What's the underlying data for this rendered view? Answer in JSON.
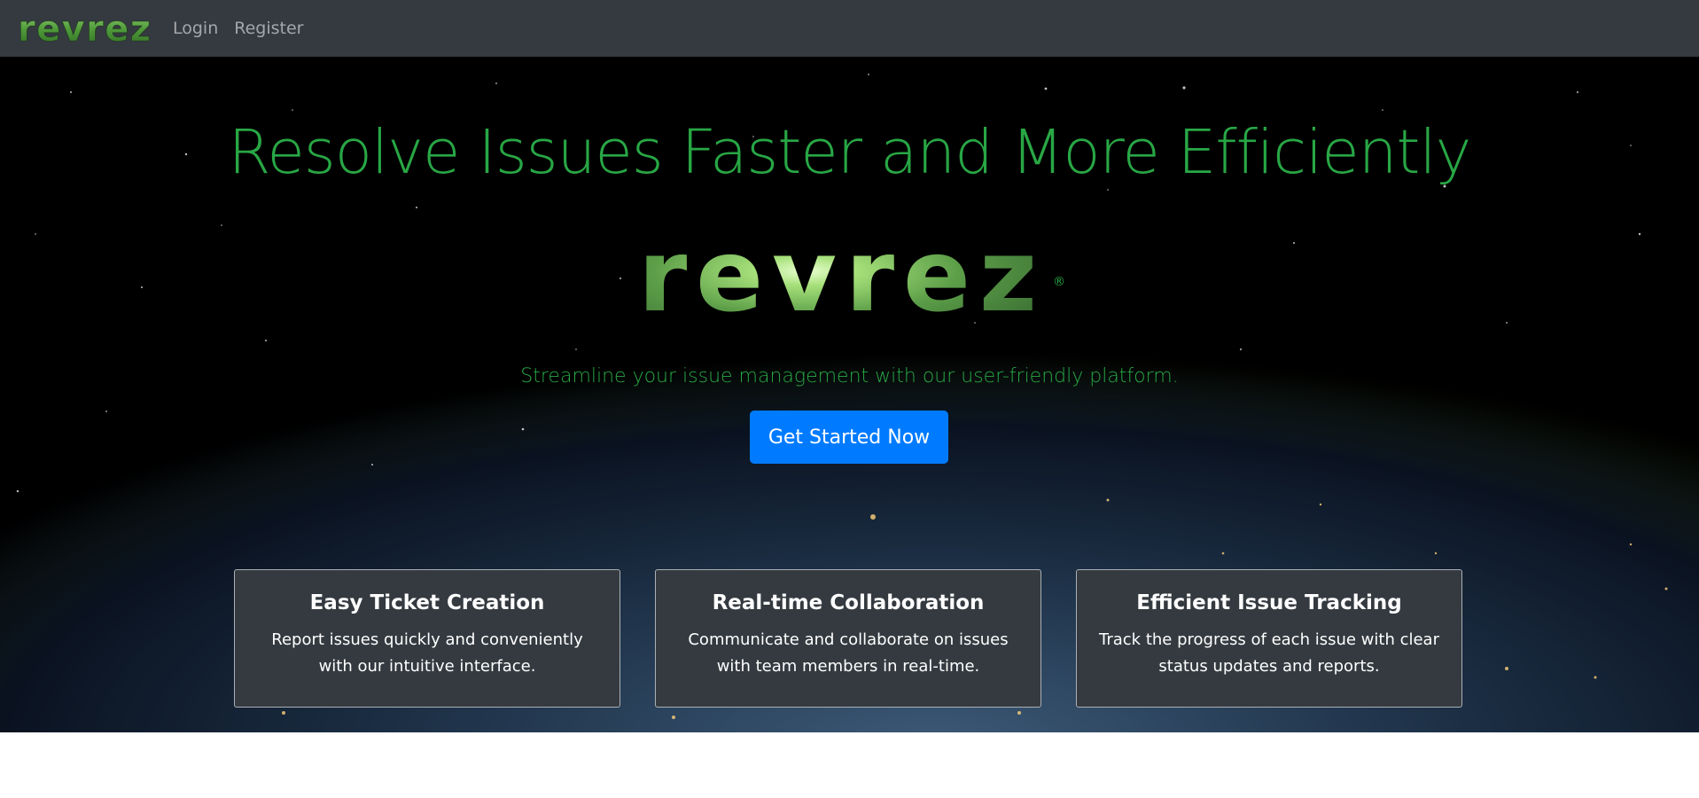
{
  "navbar": {
    "brand": "revrez",
    "links": [
      {
        "label": "Login"
      },
      {
        "label": "Register"
      }
    ],
    "background": "#343a40"
  },
  "hero": {
    "title": "Resolve Issues Faster and More Efficiently",
    "logo_text": "revrez",
    "registered_mark": "®",
    "subtitle": "Streamline your issue management with our user-friendly platform.",
    "cta_label": "Get Started Now",
    "accent_color": "#28a745",
    "cta_color": "#007bff"
  },
  "features": [
    {
      "title": "Easy Ticket Creation",
      "text": "Report issues quickly and conveniently with our intuitive interface."
    },
    {
      "title": "Real-time Collaboration",
      "text": "Communicate and collaborate on issues with team members in real-time."
    },
    {
      "title": "Efficient Issue Tracking",
      "text": "Track the progress of each issue with clear status updates and reports."
    }
  ]
}
